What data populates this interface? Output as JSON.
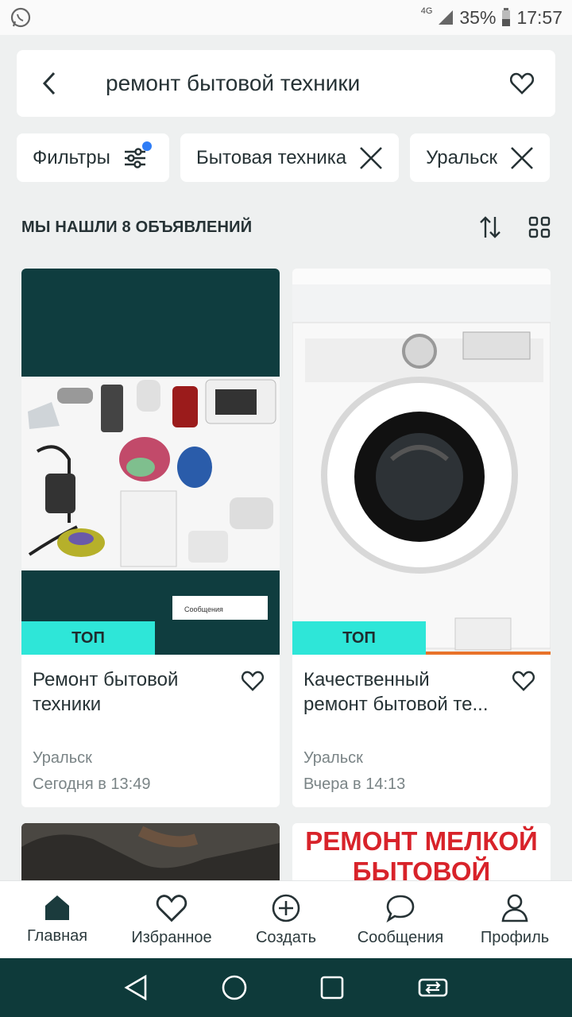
{
  "status_bar": {
    "network": "4G",
    "battery": "35%",
    "time": "17:57"
  },
  "search": {
    "query": "ремонт бытовой техники"
  },
  "chips": [
    {
      "label": "Фильтры"
    },
    {
      "label": "Бытовая техника"
    },
    {
      "label": "Уральск"
    }
  ],
  "results": {
    "count_text": "МЫ НАШЛИ 8 ОБЪЯВЛЕНИЙ"
  },
  "listings": [
    {
      "badge": "ТОП",
      "title": "Ремонт бытовой техники",
      "city": "Уральск",
      "date": "Сегодня в 13:49",
      "image_button_text": "Сообщения"
    },
    {
      "badge": "ТОП",
      "title": "Качественный ремонт бытовой те...",
      "city": "Уральск",
      "date": "Вчера в 14:13"
    },
    {
      "title": ""
    },
    {
      "image_text_1": "РЕМОНТ МЕЛКОЙ",
      "image_text_2": "БЫТОВОЙ"
    }
  ],
  "nav": [
    {
      "label": "Главная",
      "icon": "home-icon"
    },
    {
      "label": "Избранное",
      "icon": "heart-icon"
    },
    {
      "label": "Создать",
      "icon": "plus-circle-icon"
    },
    {
      "label": "Сообщения",
      "icon": "chat-icon"
    },
    {
      "label": "Профиль",
      "icon": "profile-icon"
    }
  ],
  "colors": {
    "accent_teal": "#2ee6d8",
    "dark_teal": "#0e3a3a",
    "filter_dot": "#2f7df6"
  }
}
